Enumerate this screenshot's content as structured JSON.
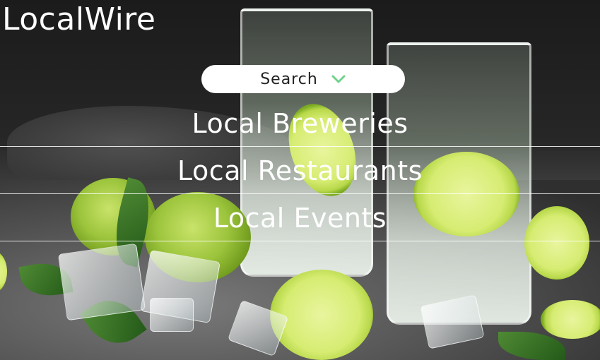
{
  "brand": {
    "name": "LocalWire"
  },
  "search": {
    "label": "Search",
    "icon": "chevron-down-icon",
    "icon_color": "#6fd28a"
  },
  "nav": {
    "items": [
      {
        "label": "Local Breweries"
      },
      {
        "label": "Local Restaurants"
      },
      {
        "label": "Local Events"
      }
    ]
  },
  "hero": {
    "description_colors": {
      "lime": "#8fbf2e",
      "background": "#2a2a2a"
    }
  }
}
